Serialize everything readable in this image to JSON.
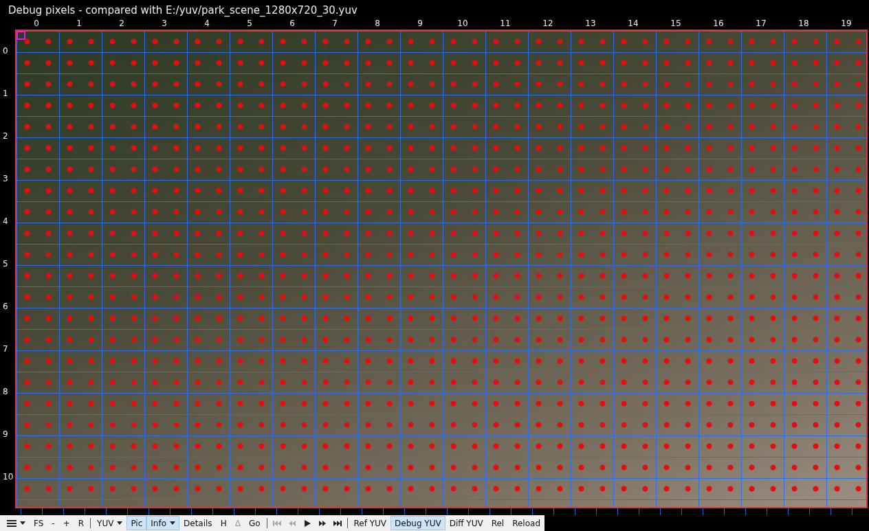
{
  "window": {
    "title": "Debug pixels - compared with E:/yuv/park_scene_1280x720_30.yuv"
  },
  "columns": [
    "0",
    "1",
    "2",
    "3",
    "4",
    "5",
    "6",
    "7",
    "8",
    "9",
    "10",
    "11",
    "12",
    "13",
    "14",
    "15",
    "16",
    "17",
    "18",
    "19"
  ],
  "rows": [
    "0",
    "1",
    "2",
    "3",
    "4",
    "5",
    "6",
    "7",
    "8",
    "9",
    "10"
  ],
  "toolbar": [
    {
      "kind": "menu",
      "dropdown": true,
      "selected": false,
      "disabled": false
    },
    {
      "kind": "text",
      "label": "FS",
      "selected": false,
      "disabled": false
    },
    {
      "kind": "text",
      "label": "-",
      "selected": false,
      "disabled": false
    },
    {
      "kind": "text",
      "label": "+",
      "selected": false,
      "disabled": false
    },
    {
      "kind": "text",
      "label": "R",
      "selected": false,
      "disabled": false
    },
    {
      "kind": "separator"
    },
    {
      "kind": "text",
      "label": "YUV",
      "dropdown": true,
      "selected": false,
      "disabled": false
    },
    {
      "kind": "text",
      "label": "Pic",
      "selected": true,
      "disabled": false
    },
    {
      "kind": "text",
      "label": "Info",
      "dropdown": true,
      "selected": true,
      "disabled": false
    },
    {
      "kind": "text",
      "label": "Details",
      "selected": false,
      "disabled": false
    },
    {
      "kind": "text",
      "label": "H",
      "selected": false,
      "disabled": false
    },
    {
      "kind": "text",
      "label": "Δ",
      "selected": false,
      "disabled": true
    },
    {
      "kind": "text",
      "label": "Go",
      "selected": false,
      "disabled": false
    },
    {
      "kind": "separator"
    },
    {
      "kind": "skip-start",
      "selected": false,
      "disabled": true
    },
    {
      "kind": "step-back",
      "selected": false,
      "disabled": true
    },
    {
      "kind": "play",
      "selected": false,
      "disabled": false
    },
    {
      "kind": "step-forward",
      "selected": false,
      "disabled": false
    },
    {
      "kind": "skip-end",
      "selected": false,
      "disabled": false
    },
    {
      "kind": "separator"
    },
    {
      "kind": "text",
      "label": "Ref YUV",
      "selected": false,
      "disabled": false
    },
    {
      "kind": "text",
      "label": "Debug YUV",
      "selected": true,
      "disabled": false
    },
    {
      "kind": "text",
      "label": "Diff YUV",
      "selected": false,
      "disabled": false
    },
    {
      "kind": "text",
      "label": "Rel",
      "selected": false,
      "disabled": false
    },
    {
      "kind": "text",
      "label": "Reload",
      "selected": false,
      "disabled": false
    }
  ]
}
